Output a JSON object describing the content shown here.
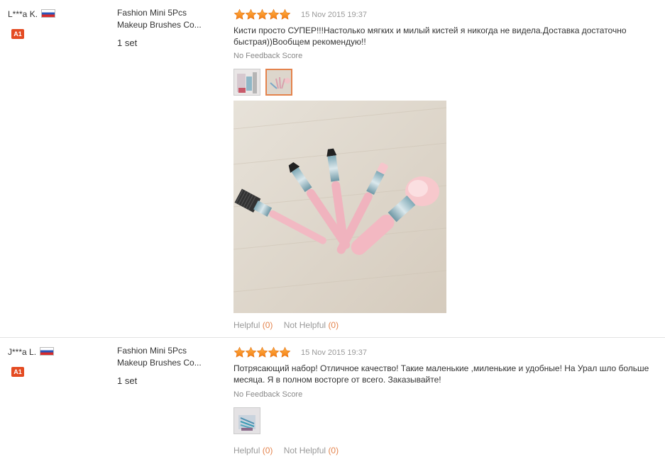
{
  "reviews": [
    {
      "buyer_name": "L***a K.",
      "buyer_country_icon": "russia-flag-icon",
      "buyer_level": "A1",
      "product_title_line1": "Fashion Mini 5Pcs",
      "product_title_line2": "Makeup Brushes Co...",
      "quantity": "1 set",
      "rating_stars": 5,
      "date": "15 Nov 2015 19:37",
      "comment_line1": "Кисти просто СУПЕР!!!Настолько мягких и милый кистей я никогда не видела.Доставка достаточно",
      "comment_line2": "быстрая))Вообщем рекомендую!!",
      "feedback_score": "No Feedback Score",
      "photo_count": 2,
      "selected_photo": 2,
      "helpful_label": "Helpful",
      "helpful_count": "(0)",
      "not_helpful_label": "Not Helpful",
      "not_helpful_count": "(0)"
    },
    {
      "buyer_name": "J***a L.",
      "buyer_country_icon": "russia-flag-icon",
      "buyer_level": "A1",
      "product_title_line1": "Fashion Mini 5Pcs",
      "product_title_line2": "Makeup Brushes Co...",
      "quantity": "1 set",
      "rating_stars": 5,
      "date": "15 Nov 2015 19:37",
      "comment_line1": "Потрясающий набор! Отличное качество! Такие маленькие ,миленькие и удобные! На Урал шло больше",
      "comment_line2": "месяца. Я в полном восторге от всего. Заказывайте!",
      "feedback_score": "No Feedback Score",
      "photo_count": 1,
      "helpful_label": "Helpful",
      "helpful_count": "(0)",
      "not_helpful_label": "Not Helpful",
      "not_helpful_count": "(0)"
    }
  ],
  "colors": {
    "star": "#f7931e",
    "accent": "#e4834c",
    "badge": "#e44b22",
    "divider": "#e3e3e3"
  }
}
